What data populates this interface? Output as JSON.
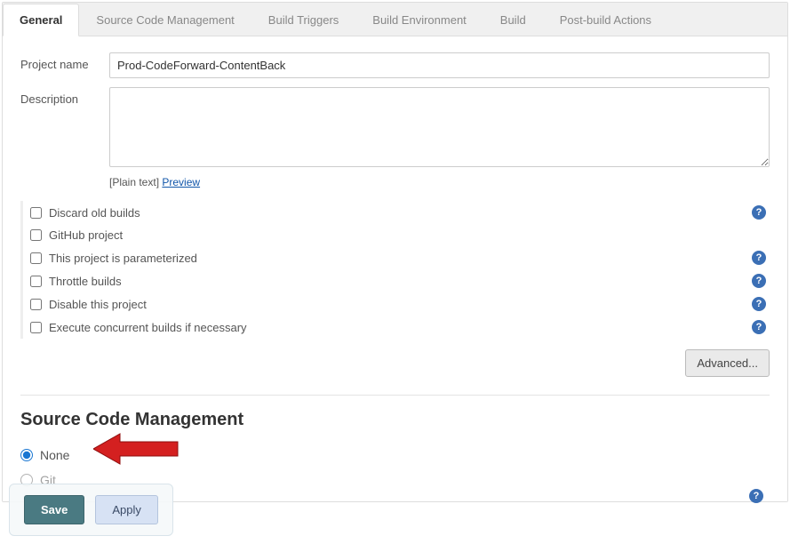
{
  "tabs": [
    {
      "label": "General",
      "active": true
    },
    {
      "label": "Source Code Management",
      "active": false
    },
    {
      "label": "Build Triggers",
      "active": false
    },
    {
      "label": "Build Environment",
      "active": false
    },
    {
      "label": "Build",
      "active": false
    },
    {
      "label": "Post-build Actions",
      "active": false
    }
  ],
  "general": {
    "project_name_label": "Project name",
    "project_name_value": "Prod-CodeForward-ContentBack",
    "description_label": "Description",
    "description_value": "",
    "plain_text_label": "[Plain text]",
    "preview_link": "Preview"
  },
  "options": [
    {
      "label": "Discard old builds",
      "has_help": true
    },
    {
      "label": "GitHub project",
      "has_help": false
    },
    {
      "label": "This project is parameterized",
      "has_help": true
    },
    {
      "label": "Throttle builds",
      "has_help": true
    },
    {
      "label": "Disable this project",
      "has_help": true
    },
    {
      "label": "Execute concurrent builds if necessary",
      "has_help": true
    }
  ],
  "advanced_button": "Advanced...",
  "scm": {
    "title": "Source Code Management",
    "options": [
      {
        "label": "None",
        "checked": true
      },
      {
        "label": "Git",
        "checked": false
      }
    ]
  },
  "footer": {
    "save": "Save",
    "apply": "Apply"
  }
}
